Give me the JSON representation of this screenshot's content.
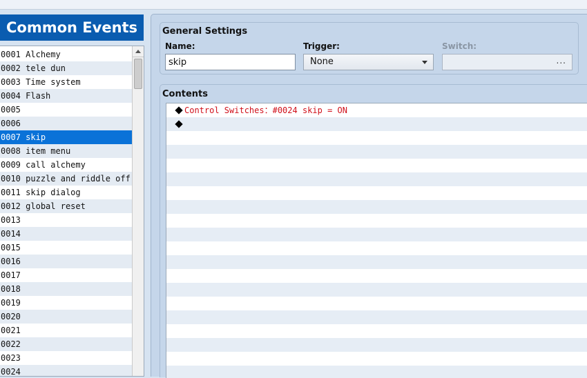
{
  "left_panel": {
    "title": "Common Events",
    "items": [
      {
        "id": "0001",
        "name": "Alchemy"
      },
      {
        "id": "0002",
        "name": "tele dun"
      },
      {
        "id": "0003",
        "name": "Time system"
      },
      {
        "id": "0004",
        "name": "Flash"
      },
      {
        "id": "0005",
        "name": ""
      },
      {
        "id": "0006",
        "name": ""
      },
      {
        "id": "0007",
        "name": "skip"
      },
      {
        "id": "0008",
        "name": "item menu"
      },
      {
        "id": "0009",
        "name": "call alchemy"
      },
      {
        "id": "0010",
        "name": "puzzle and riddle off"
      },
      {
        "id": "0011",
        "name": "skip dialog"
      },
      {
        "id": "0012",
        "name": "global reset"
      },
      {
        "id": "0013",
        "name": ""
      },
      {
        "id": "0014",
        "name": ""
      },
      {
        "id": "0015",
        "name": ""
      },
      {
        "id": "0016",
        "name": ""
      },
      {
        "id": "0017",
        "name": ""
      },
      {
        "id": "0018",
        "name": ""
      },
      {
        "id": "0019",
        "name": ""
      },
      {
        "id": "0020",
        "name": ""
      },
      {
        "id": "0021",
        "name": ""
      },
      {
        "id": "0022",
        "name": ""
      },
      {
        "id": "0023",
        "name": ""
      },
      {
        "id": "0024",
        "name": ""
      }
    ],
    "selected_id": "0007"
  },
  "general_settings": {
    "title": "General Settings",
    "name_label": "Name:",
    "name_value": "skip",
    "trigger_label": "Trigger:",
    "trigger_value": "None",
    "switch_label": "Switch:",
    "switch_button": "..."
  },
  "contents": {
    "title": "Contents",
    "commands": [
      {
        "text": "Control Switches：#0024 skip = ON"
      },
      {
        "text": ""
      }
    ],
    "empty_rows": 18
  },
  "colors": {
    "title_bar": "#0a5cb0",
    "selection": "#0a72d8",
    "command_text": "#d0101a"
  }
}
